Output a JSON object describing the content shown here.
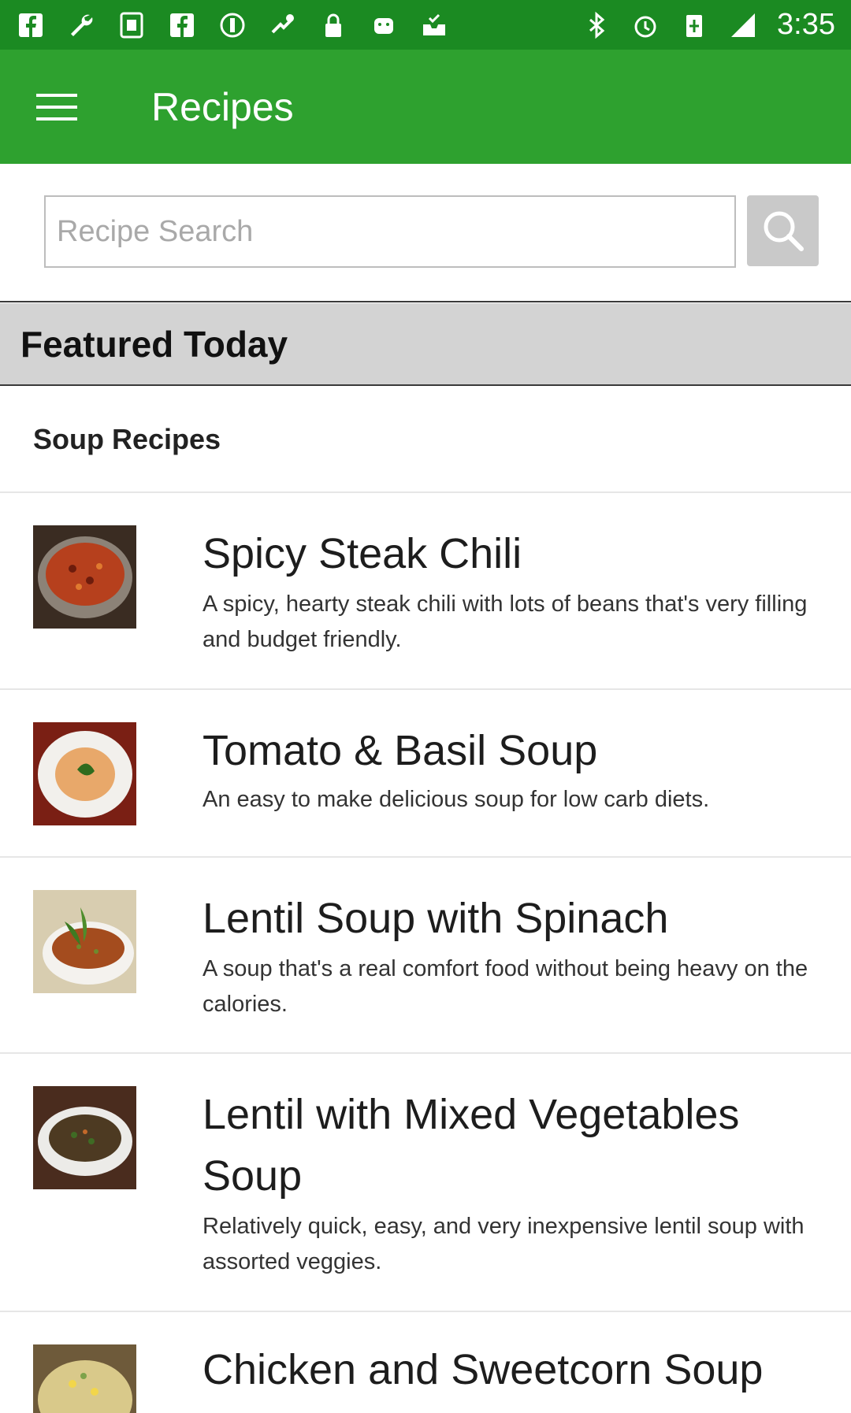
{
  "status_bar": {
    "time": "3:35",
    "left_icons": [
      "facebook-icon",
      "wrench-icon",
      "sim-toolkit-icon",
      "facebook-icon",
      "data-saver-icon",
      "fake-gps-icon",
      "lock-icon",
      "android-icon",
      "inbox-check-icon"
    ],
    "right_icons": [
      "bluetooth-icon",
      "alarm-icon",
      "battery-saver-icon",
      "signal-icon"
    ],
    "colors": {
      "background": "#1b8a22"
    }
  },
  "app_bar": {
    "title": "Recipes",
    "menu_icon": "hamburger-menu-icon",
    "colors": {
      "background": "#2ea12f",
      "text": "#ffffff"
    }
  },
  "search": {
    "placeholder": "Recipe Search",
    "value": "",
    "button_icon": "search-icon"
  },
  "featured": {
    "title": "Featured Today"
  },
  "section": {
    "title": "Soup Recipes"
  },
  "recipes": [
    {
      "name": "Spicy Steak Chili",
      "description": "A spicy, hearty steak chili with lots of beans that's very filling and budget friendly.",
      "thumbnail": "chili-bowl-image"
    },
    {
      "name": "Tomato & Basil Soup",
      "description": "An easy to make delicious soup for low carb diets.",
      "thumbnail": "tomato-soup-image"
    },
    {
      "name": "Lentil Soup with Spinach",
      "description": "A soup that's a real comfort food without being heavy on the calories.",
      "thumbnail": "lentil-soup-image"
    },
    {
      "name": "Lentil with Mixed Vegetables Soup",
      "description": "Relatively quick, easy, and very inexpensive lentil soup with assorted veggies.",
      "thumbnail": "vegetable-lentil-soup-image"
    },
    {
      "name": "Chicken and Sweetcorn Soup",
      "description": "",
      "thumbnail": "sweetcorn-soup-image"
    }
  ]
}
